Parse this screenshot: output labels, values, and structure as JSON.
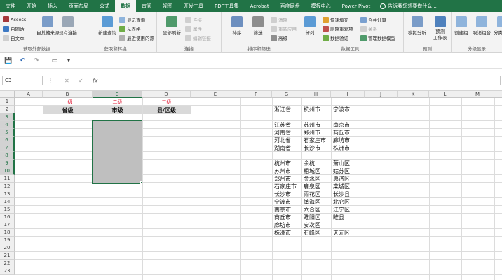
{
  "tabs": [
    "文件",
    "开始",
    "插入",
    "页面布局",
    "公式",
    "数据",
    "审阅",
    "视图",
    "开发工具",
    "PDF工具集",
    "Acrobat",
    "百度网盘",
    "模板中心",
    "Power Pivot"
  ],
  "tell_me": "告诉我您想要做什么...",
  "ribbon": {
    "get_external": {
      "access": "Access",
      "web": "自网站",
      "text": "自文本",
      "other": "自其他来源",
      "existing": "现有连接",
      "name": "获取外部数据"
    },
    "get_transform": {
      "new_query": "新建查询",
      "show_queries": "显示查询",
      "from_table": "从表格",
      "recent": "最近使用的源",
      "name": "获取和转换"
    },
    "connections": {
      "refresh_all": "全部刷新",
      "connections": "连接",
      "properties": "属性",
      "edit_links": "编辑链接",
      "name": "连接"
    },
    "sort_filter": {
      "sort": "排序",
      "filter": "筛选",
      "clear": "清除",
      "reapply": "重新应用",
      "advanced": "高级",
      "name": "排序和筛选"
    },
    "data_tools": {
      "text_to_columns": "分列",
      "flash_fill": "快速填充",
      "remove_dup": "删除重复项",
      "validation": "数据验证",
      "consolidate": "合并计算",
      "relationships": "关系",
      "manage_model": "管理数据模型",
      "name": "数据工具"
    },
    "forecast": {
      "what_if": "模拟分析",
      "sheet": "预测\n工作表",
      "name": "预测"
    },
    "outline": {
      "group": "创建组",
      "ungroup": "取消组合",
      "subtotal": "分类汇总",
      "name": "分级显示"
    }
  },
  "qat": {
    "save": "💾",
    "undo": "↶",
    "redo": "↷"
  },
  "formula_bar": {
    "name_box": "C3",
    "cancel": "✕",
    "enter": "✓",
    "fx": "fx",
    "value": ""
  },
  "columns": [
    "A",
    "B",
    "C",
    "D",
    "E",
    "F",
    "G",
    "H",
    "I",
    "J",
    "K",
    "L",
    "M",
    "N"
  ],
  "rows": [
    "1",
    "2",
    "3",
    "4",
    "5",
    "6",
    "7",
    "8",
    "9",
    "10",
    "11",
    "12",
    "13",
    "14",
    "15",
    "16",
    "17",
    "18",
    "19",
    "20",
    "21",
    "22",
    "23"
  ],
  "sheet": {
    "levels": {
      "b": "一级",
      "c": "二级",
      "d": "三级"
    },
    "headers": {
      "b": "省级",
      "c": "市级",
      "d": "县/区级"
    },
    "g_rows": [
      [
        "浙江省",
        "杭州市",
        "宁波市"
      ],
      [
        "江苏省",
        "苏州市",
        "南京市"
      ],
      [
        "河南省",
        "郑州市",
        "商丘市"
      ],
      [
        "河北省",
        "石家庄市",
        "廊坊市"
      ],
      [
        "湖南省",
        "长沙市",
        "株洲市"
      ]
    ],
    "h_rows": [
      [
        "杭州市",
        "余杭",
        "萧山区"
      ],
      [
        "苏州市",
        "相城区",
        "姑苏区"
      ],
      [
        "郑州市",
        "金水区",
        "惠济区"
      ],
      [
        "石家庄市",
        "鹿泉区",
        "栾城区"
      ],
      [
        "长沙市",
        "雨花区",
        "长沙县"
      ],
      [
        "宁波市",
        "镇海区",
        "北仑区"
      ],
      [
        "南京市",
        "六合区",
        "江宁区"
      ],
      [
        "商丘市",
        "睢阳区",
        "睢县"
      ],
      [
        "廊坊市",
        "安次区",
        ""
      ],
      [
        "株洲市",
        "石峰区",
        "天元区"
      ]
    ]
  },
  "colors": {
    "accent": "#217346",
    "level": "#e0203a",
    "header_fill": "#d9d9d9",
    "selection_fill": "#bfbfbf"
  }
}
